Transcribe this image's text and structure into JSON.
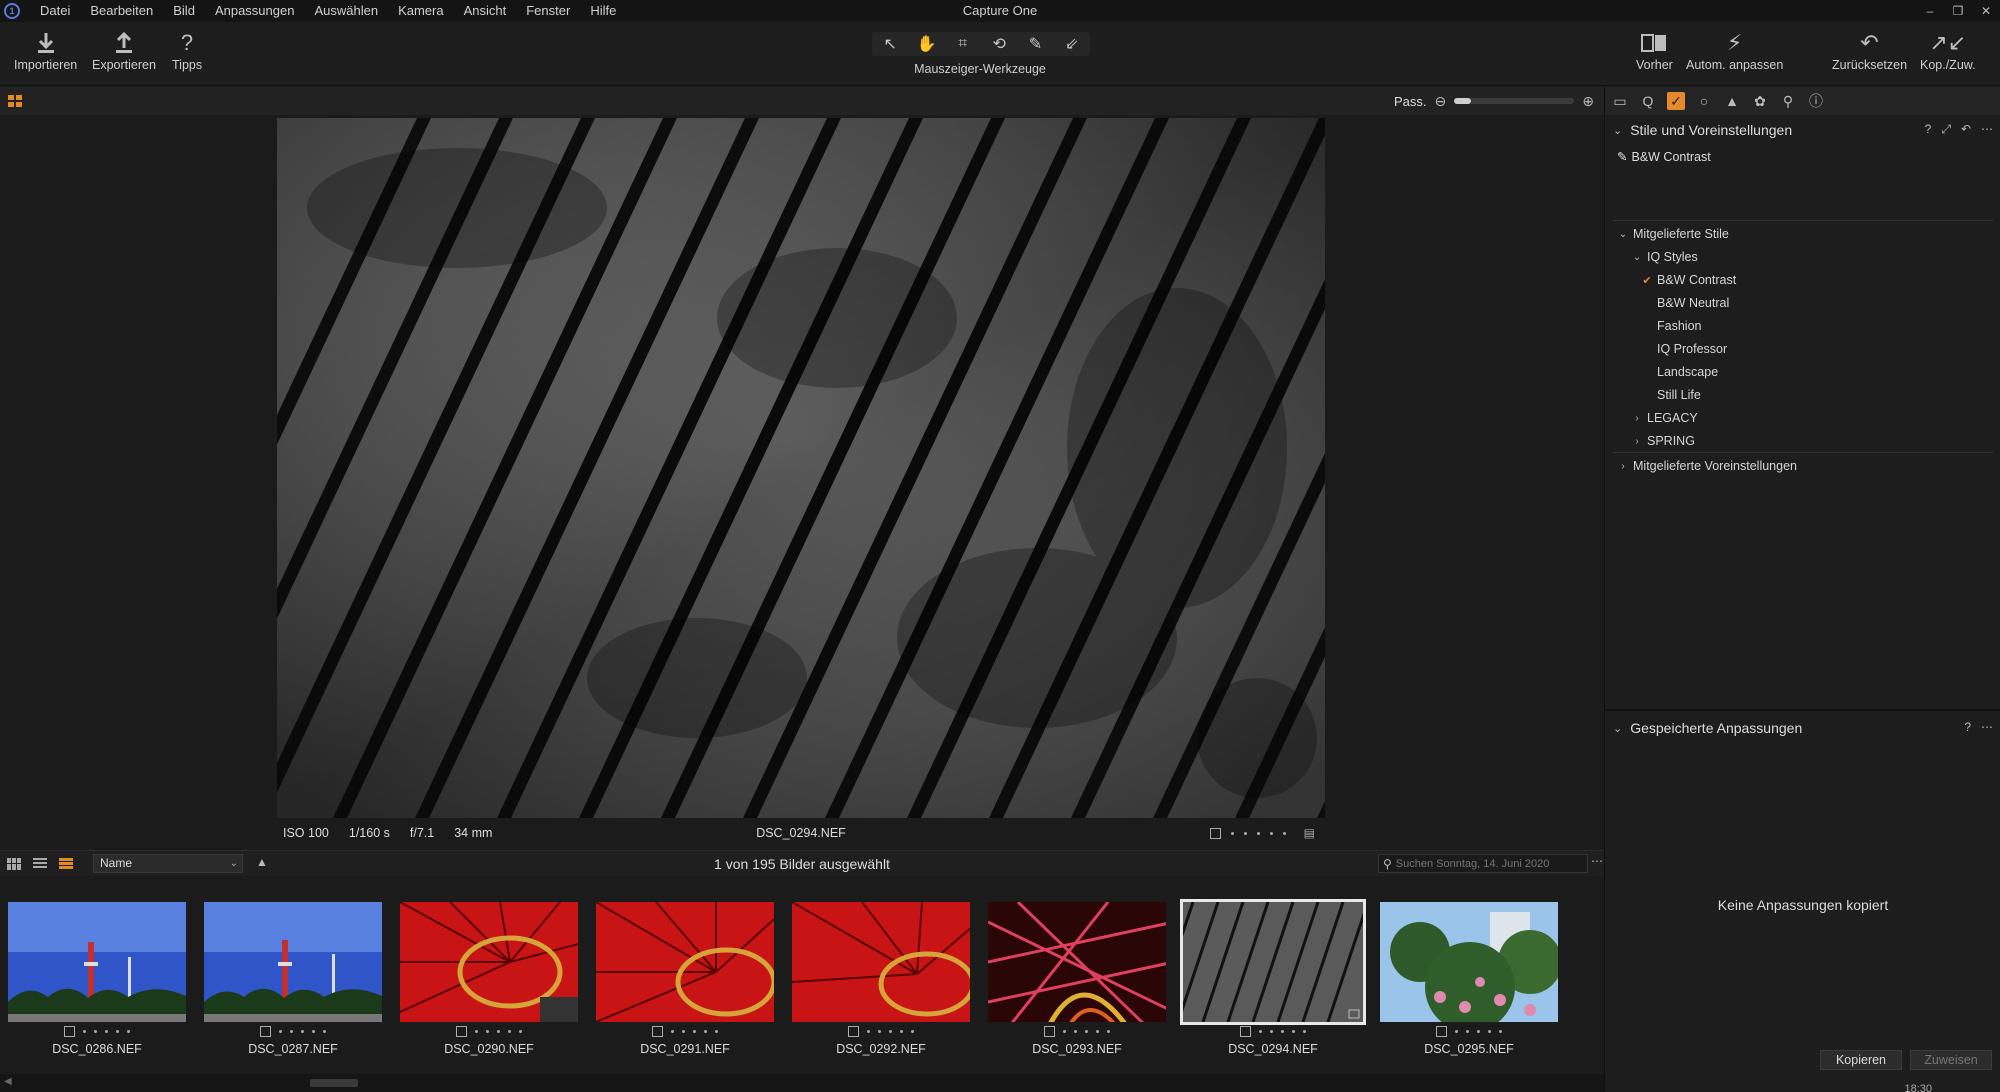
{
  "window": {
    "title": "Capture One",
    "controls": [
      "–",
      "❐",
      "✕"
    ]
  },
  "menu": [
    "Datei",
    "Bearbeiten",
    "Bild",
    "Anpassungen",
    "Auswählen",
    "Kamera",
    "Ansicht",
    "Fenster",
    "Hilfe"
  ],
  "toolbar": {
    "import_label": "Importieren",
    "export_label": "Exportieren",
    "tips_label": "Tipps",
    "cursor_tools_label": "Mauszeiger-Werkzeuge",
    "previous_label": "Vorher",
    "auto_adjust_label": "Autom. anpassen",
    "reset_label": "Zurücksetzen",
    "copy_apply_label": "Kop./Zuw."
  },
  "viewer": {
    "zoom_label": "Pass.",
    "zoom_level": 0.14,
    "iso": "ISO 100",
    "shutter": "1/160 s",
    "aperture": "f/7.1",
    "focal_length": "34 mm",
    "filename": "DSC_0294.NEF"
  },
  "browser": {
    "sort_value": "Name",
    "selection_count": "1 von 195 Bilder ausgewählt",
    "search_placeholder": "Suchen Sonntag, 14. Juni 2020",
    "thumbnails": [
      {
        "name": "DSC_0286.NEF"
      },
      {
        "name": "DSC_0287.NEF"
      },
      {
        "name": "DSC_0290.NEF"
      },
      {
        "name": "DSC_0291.NEF"
      },
      {
        "name": "DSC_0292.NEF"
      },
      {
        "name": "DSC_0293.NEF"
      },
      {
        "name": "DSC_0294.NEF"
      },
      {
        "name": "DSC_0295.NEF"
      }
    ]
  },
  "styles_panel": {
    "title": "Stile und Voreinstellungen",
    "applied_style": "B&W Contrast",
    "tree": {
      "builtin_styles": "Mitgelieferte Stile",
      "iq_styles": "IQ Styles",
      "iq_items": [
        "B&W Contrast",
        "B&W Neutral",
        "Fashion",
        "IQ Professor",
        "Landscape",
        "Still Life"
      ],
      "legacy": "LEGACY",
      "spring": "SPRING",
      "builtin_presets": "Mitgelieferte Voreinstellungen"
    }
  },
  "saved_panel": {
    "title": "Gespeicherte Anpassungen",
    "empty_message": "Keine Anpassungen kopiert",
    "copy_button": "Kopieren",
    "apply_button": "Zuweisen"
  },
  "clock": "18:30",
  "colors": {
    "accent": "#e58a2c",
    "background": "#1b1b1b",
    "panel": "#1d1d1d"
  }
}
